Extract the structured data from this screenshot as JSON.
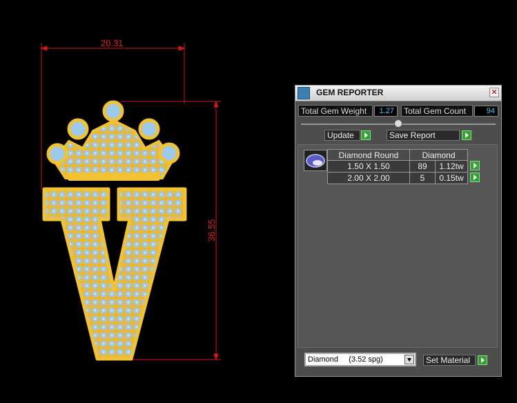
{
  "viewport": {
    "dimension_width": "20.31",
    "dimension_height": "36.55"
  },
  "panel": {
    "title": "GEM REPORTER",
    "close_glyph": "✕",
    "total_weight_label": "Total Gem Weight",
    "total_weight_value": "1.27",
    "total_count_label": "Total Gem Count",
    "total_count_value": "94",
    "update_label": "Update",
    "save_report_label": "Save Report",
    "table": {
      "header_shape": "Diamond Round",
      "header_material": "Diamond",
      "rows": [
        {
          "size": "1.50 X 1.50",
          "count": "89",
          "weight": "1.12tw"
        },
        {
          "size": "2.00 X 2.00",
          "count": "5",
          "weight": "0.15tw"
        }
      ]
    },
    "material_select": "Diamond     (3.52 spg)",
    "set_material_label": "Set Material",
    "accent_color": "#2fa52f",
    "value_color": "#4fc3f7"
  }
}
